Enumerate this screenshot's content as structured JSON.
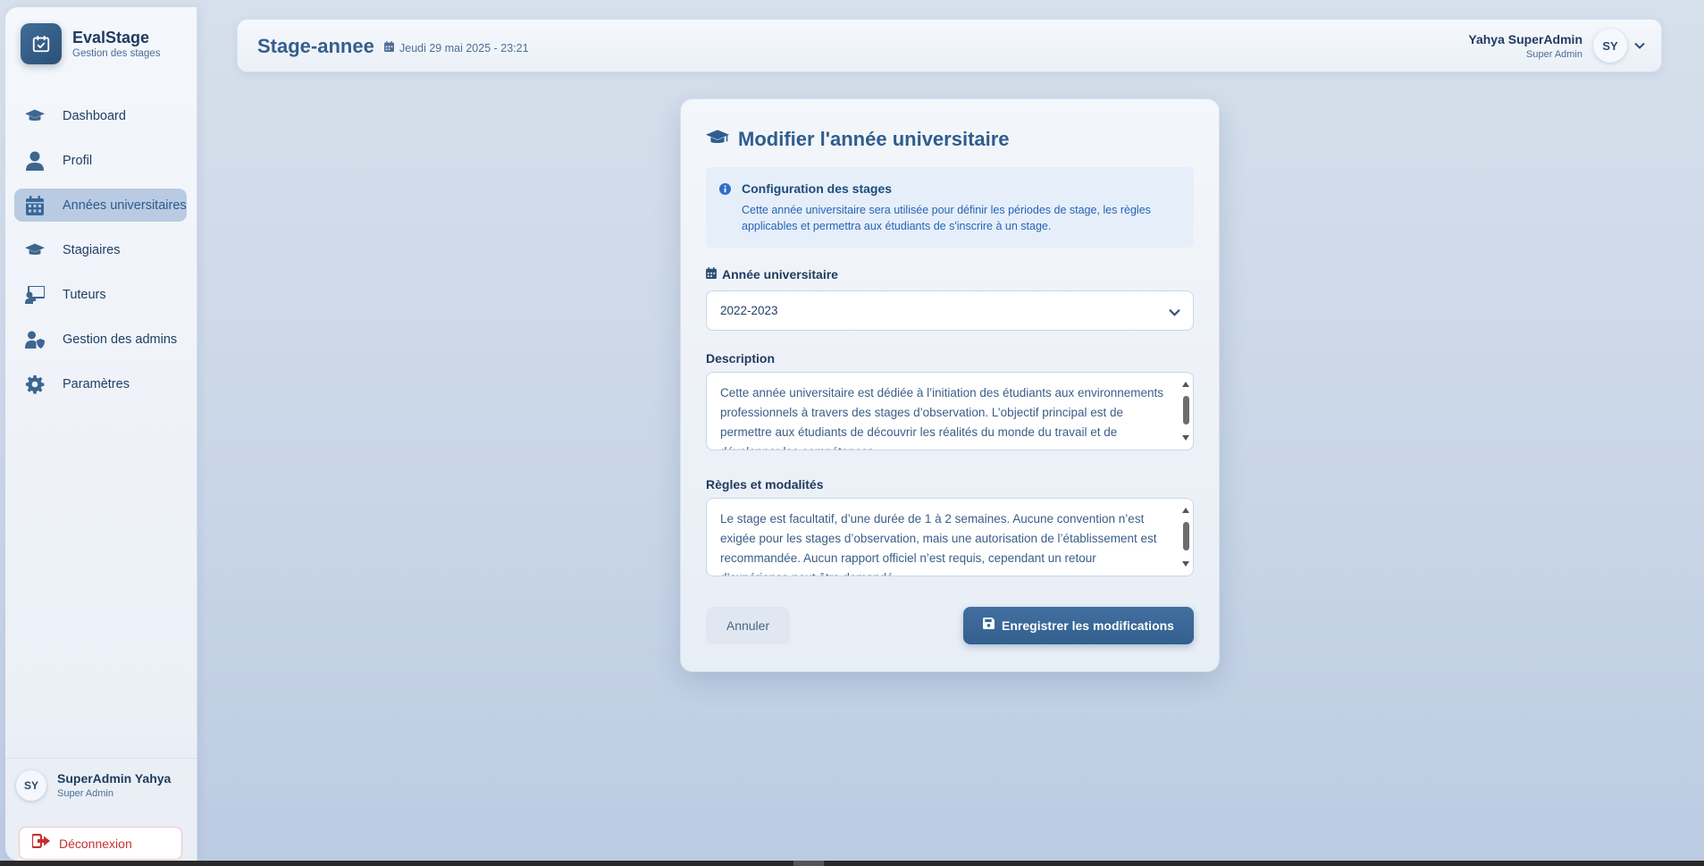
{
  "brand": {
    "name": "EvalStage",
    "subtitle": "Gestion des stages"
  },
  "sidebar": {
    "items": [
      {
        "label": "Dashboard",
        "icon": "graduation-cap-icon",
        "active": false
      },
      {
        "label": "Profil",
        "icon": "user-icon",
        "active": false
      },
      {
        "label": "Années universitaires",
        "icon": "calendar-icon",
        "active": true
      },
      {
        "label": "Stagiaires",
        "icon": "graduation-cap-icon",
        "active": false
      },
      {
        "label": "Tuteurs",
        "icon": "chalkboard-teacher-icon",
        "active": false
      },
      {
        "label": "Gestion des admins",
        "icon": "user-shield-icon",
        "active": false
      },
      {
        "label": "Paramètres",
        "icon": "gear-icon",
        "active": false
      }
    ],
    "user": {
      "initials": "SY",
      "name": "SuperAdmin Yahya",
      "role": "Super Admin"
    },
    "logout_label": "Déconnexion"
  },
  "header": {
    "title": "Stage-annee",
    "datetime": "Jeudi 29 mai 2025 - 23:21",
    "user": {
      "name": "Yahya SuperAdmin",
      "role": "Super Admin",
      "initials": "SY"
    }
  },
  "modal": {
    "title": "Modifier l'année universitaire",
    "info": {
      "title": "Configuration des stages",
      "text": "Cette année universitaire sera utilisée pour définir les périodes de stage, les règles applicables et permettra aux étudiants de s'inscrire à un stage."
    },
    "year_label": "Année universitaire",
    "year_value": "2022-2023",
    "description_label": "Description",
    "description_value": "Cette année universitaire est dédiée à l’initiation des étudiants aux environnements professionnels à travers des stages d’observation. L’objectif principal est de permettre aux étudiants de découvrir les réalités du monde du travail et de développer les compétences",
    "rules_label": "Règles et modalités",
    "rules_value": "Le stage est facultatif, d’une durée de 1 à 2 semaines. Aucune convention n’est exigée pour les stages d’observation, mais une autorisation de l’établissement est recommandée. Aucun rapport officiel n’est requis, cependant un retour d’expérience peut être demandé.",
    "cancel_label": "Annuler",
    "save_label": "Enregistrer les modifications"
  },
  "colors": {
    "accent": "#3a6897",
    "danger": "#c62f2f",
    "info_text": "#2563b8"
  }
}
